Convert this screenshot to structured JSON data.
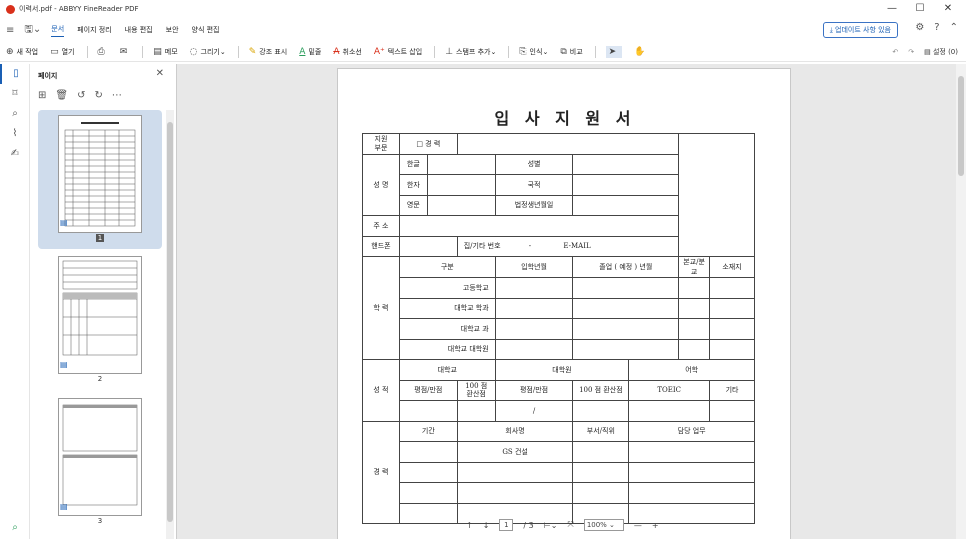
{
  "window": {
    "title": "이력서.pdf - ABBYY FineReader PDF",
    "minimize": "—",
    "maximize": "☐",
    "close": "✕"
  },
  "menu": {
    "items": [
      "문서",
      "페이지 정리",
      "내용 편집",
      "보안",
      "양식 편집"
    ],
    "update_button": "업데이트 사항 있음"
  },
  "toolbar": {
    "new": "새 작업",
    "open": "열기",
    "memo": "메모",
    "draw": "그리기",
    "highlight": "강조 표시",
    "underline": "밑줄",
    "strike": "취소선",
    "insert_text": "텍스트 삽입",
    "stamp": "스탬프 추가",
    "recognize": "인식",
    "compare": "비교",
    "settings": "설정 (0)"
  },
  "panel": {
    "title": "페이지",
    "pages": [
      "1",
      "2",
      "3"
    ]
  },
  "document": {
    "title": "입 사 지 원 서",
    "field_apply": "지원\n부문",
    "checkbox_career": "□ 경 력",
    "name_label": "성 명",
    "hangul": "한글",
    "hanja": "한자",
    "english": "영문",
    "gender": "성별",
    "nationality": "국적",
    "birth": "법정생년월일",
    "address": "주 소",
    "phone": "핸드폰",
    "home_phone": "집/기타 번호",
    "dash": "-",
    "email": "E-MAIL",
    "education": "학 력",
    "edu_headers": [
      "구분",
      "입학년월",
      "졸업 ( 예정 ) 년월",
      "본교/분교",
      "소재지"
    ],
    "edu_rows": [
      "고등학교",
      "대학교 학과",
      "대학교 과",
      "대학교 대학원"
    ],
    "grades": "성 적",
    "grade_university": "대학교",
    "grade_graduate": "대학원",
    "grade_language": "어학",
    "grade_headers": [
      "평점/만점",
      "100 점\n환산점",
      "평점/만점",
      "100 점 환산점",
      "TOEIC",
      "기타"
    ],
    "slash": "/",
    "career": "경 력",
    "career_headers": [
      "기간",
      "회사명",
      "부서/직위",
      "담당 업무"
    ],
    "career_company": "GS 건설"
  },
  "nav": {
    "page_current": "1",
    "page_total": "/ 3",
    "zoom": "100%"
  }
}
